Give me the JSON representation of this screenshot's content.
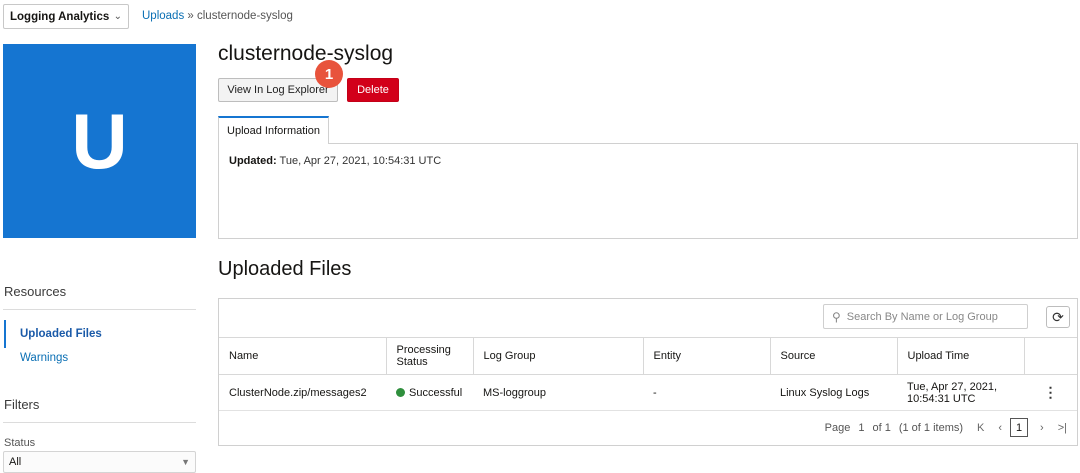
{
  "service_select": {
    "label": "Logging Analytics"
  },
  "breadcrumb": {
    "link": "Uploads",
    "separator": " » ",
    "current": "clusternode-syslog"
  },
  "tile": {
    "letter": "U"
  },
  "sidebar": {
    "resources_heading": "Resources",
    "items": [
      {
        "label": "Uploaded Files"
      },
      {
        "label": "Warnings"
      }
    ],
    "filters_heading": "Filters",
    "status_label": "Status",
    "status_value": "All"
  },
  "header": {
    "title": "clusternode-syslog",
    "view_button": "View In Log Explorer",
    "delete_button": "Delete",
    "badge": "1"
  },
  "tabs": [
    {
      "label": "Upload Information"
    }
  ],
  "info": {
    "updated_label": "Updated:",
    "updated_value": " Tue, Apr 27, 2021, 10:54:31 UTC"
  },
  "files": {
    "title": "Uploaded Files",
    "search_placeholder": "Search By Name or Log Group",
    "columns": [
      "Name",
      "Processing Status",
      "Log Group",
      "Entity",
      "Source",
      "Upload Time"
    ],
    "rows": [
      {
        "name": "ClusterNode.zip/messages2",
        "status": "Successful",
        "log_group": "MS-loggroup",
        "entity": "-",
        "source": "Linux Syslog Logs",
        "upload_time": "Tue, Apr 27, 2021, 10:54:31 UTC"
      }
    ],
    "pager": {
      "page_label": "Page",
      "page": "1",
      "of": "of 1",
      "items": "(1 of 1 items)",
      "current": "1"
    }
  },
  "colors": {
    "accent": "#1575d1",
    "danger": "#d2001a",
    "badge": "#e8533c",
    "success": "#2f8f3d"
  }
}
